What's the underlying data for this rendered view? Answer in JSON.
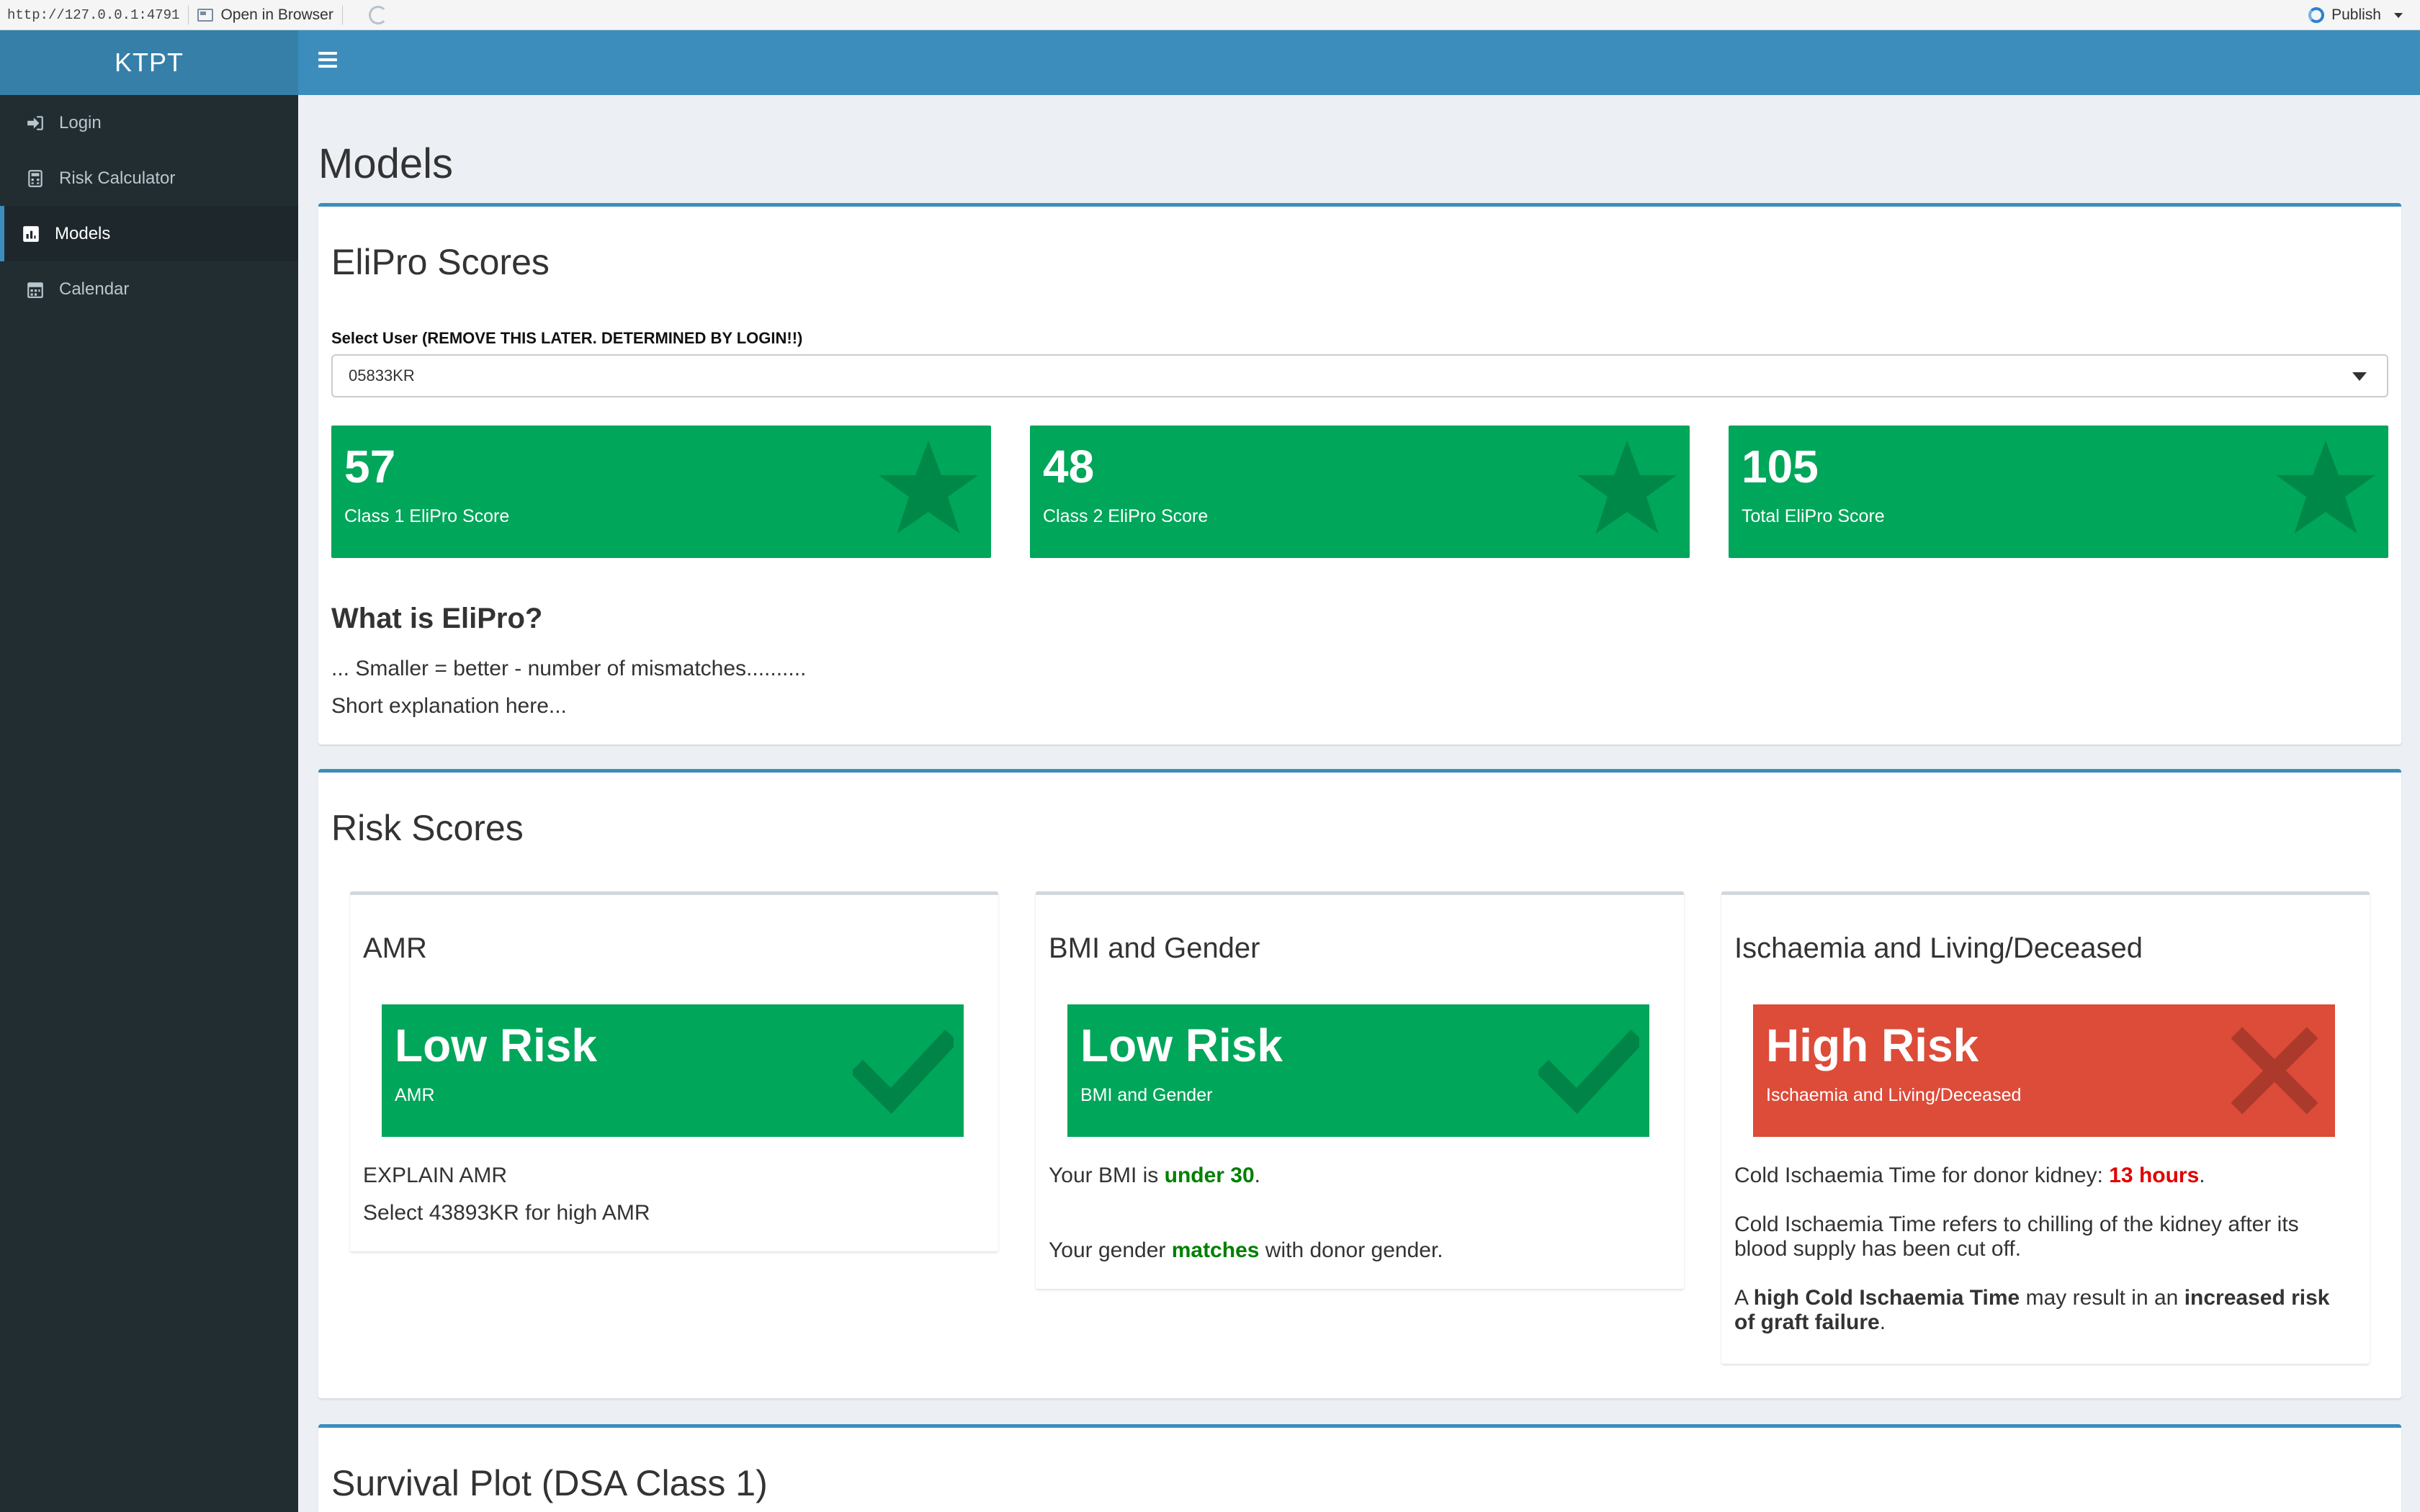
{
  "viewer": {
    "url": "http://127.0.0.1:4791",
    "open_in_browser": "Open in Browser",
    "publish": "Publish"
  },
  "sidebar": {
    "logo": "KTPT",
    "items": [
      {
        "label": "Login",
        "icon": "sign-in-icon",
        "active": false
      },
      {
        "label": "Risk Calculator",
        "icon": "calculator-icon",
        "active": false
      },
      {
        "label": "Models",
        "icon": "bar-chart-icon",
        "active": true
      },
      {
        "label": "Calendar",
        "icon": "calendar-icon",
        "active": false
      }
    ]
  },
  "page": {
    "title": "Models"
  },
  "elipro": {
    "title": "EliPro Scores",
    "select_label": "Select User (REMOVE THIS LATER. DETERMINED BY LOGIN!!)",
    "select_value": "05833KR",
    "scores": [
      {
        "value": "57",
        "label": "Class 1 EliPro Score",
        "icon": "star-icon"
      },
      {
        "value": "48",
        "label": "Class 2 EliPro Score",
        "icon": "star-icon"
      },
      {
        "value": "105",
        "label": "Total EliPro Score",
        "icon": "star-icon"
      }
    ],
    "what_title": "What is EliPro?",
    "line1": "... Smaller = better - number of mismatches..........",
    "line2": "Short explanation here..."
  },
  "risk": {
    "title": "Risk Scores",
    "cards": [
      {
        "title": "AMR",
        "status": "Low Risk",
        "sub": "AMR",
        "color": "#00a65a",
        "icon": "check-icon",
        "explain1": "EXPLAIN AMR",
        "explain2": "Select 43893KR for high AMR"
      },
      {
        "title": "BMI and Gender",
        "status": "Low Risk",
        "sub": "BMI and Gender",
        "color": "#00a65a",
        "icon": "check-icon",
        "bmi_prefix": "Your BMI is ",
        "bmi_value": "under 30",
        "bmi_suffix": ".",
        "gender_prefix": "Your gender ",
        "gender_value": "matches",
        "gender_suffix": " with donor gender."
      },
      {
        "title": "Ischaemia and Living/Deceased",
        "status": "High Risk",
        "sub": "Ischaemia and Living/Deceased",
        "color": "#dd4b39",
        "icon": "times-icon",
        "cit_prefix": "Cold Ischaemia Time for donor kidney: ",
        "cit_value": "13 hours",
        "cit_suffix": ".",
        "cit_def": "Cold Ischaemia Time refers to chilling of the kidney after its blood supply has been cut off.",
        "warn_a": "A ",
        "warn_b": "high Cold Ischaemia Time",
        "warn_c": " may result in an ",
        "warn_d": "increased risk of graft failure",
        "warn_e": "."
      }
    ]
  },
  "survival": {
    "title": "Survival Plot (DSA Class 1)"
  }
}
